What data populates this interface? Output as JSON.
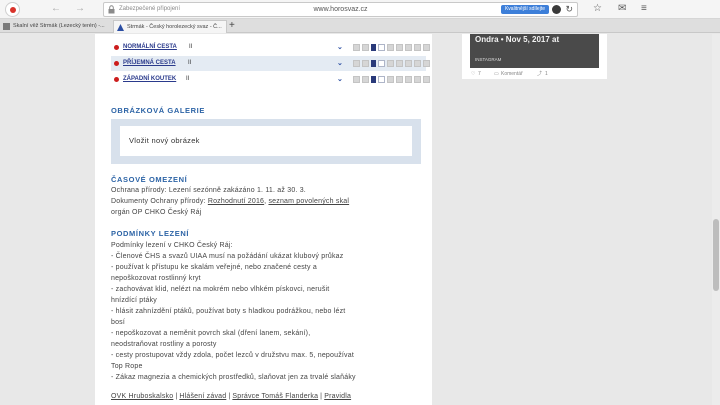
{
  "browser": {
    "secure_label": "Zabezpečené připojení",
    "url": "www.horosvaz.cz",
    "ad_button": "Kvalitnější sdílejte",
    "back_icon": "back-arrow-icon",
    "forward_icon": "forward-arrow-icon",
    "reload_icon": "reload-icon",
    "icons": {
      "star": "☆",
      "mail": "✉",
      "menu": "≡"
    },
    "tabs": [
      {
        "label": "Skalní věž Strmák (Lezecký terén) -..."
      },
      {
        "label": "Strmák - Český horolezecký svaz - Č..."
      }
    ],
    "new_tab": "+"
  },
  "routes": [
    {
      "name": "NORMÁLNÍ CESTA",
      "grade": "II"
    },
    {
      "name": "PŘÍJEMNÁ CESTA",
      "grade": "II"
    },
    {
      "name": "ZÁPADNÍ KOUTEK",
      "grade": "II"
    }
  ],
  "gallery": {
    "heading": "OBRÁZKOVÁ GALERIE",
    "add_label": "Vložit nový obrázek"
  },
  "seasonal": {
    "heading": "ČASOVÉ OMEZENÍ",
    "line1": "Ochrana přírody: Lezení sezónně zakázáno 1. 11. až 30. 3.",
    "line2_prefix": "Dokumenty Ochrany přírody: ",
    "link1": "Rozhodnutí 2016",
    "line2_mid": ", ",
    "link2": "seznam povolených skal",
    "line3": "orgán OP CHKO Český Ráj"
  },
  "conditions": {
    "heading": "PODMÍNKY LEZENÍ",
    "lines": [
      "Podmínky lezení v CHKO Český Ráj:",
      "- Členové ČHS a svazů UIAA musí na požádání ukázat klubový průkaz",
      "- používat k přístupu ke skalám veřejné, nebo značené cesty a",
      "nepoškozovat rostlinný kryt",
      "- zachovávat klid, nelézt na mokrém nebo vlhkém pískovci, nerušit",
      "hnízdící ptáky",
      "- hlásit zahnízdění ptáků, používat boty s hladkou podrážkou, nebo lézt",
      "bosí",
      "- nepoškozovat a neměnit povrch skal (dření lanem, sekání),",
      "neodstraňovat rostliny a porosty",
      "- cesty prostupovat vždy zdola, počet lezců v družstvu max. 5, nepoužívat",
      "Top Rope",
      "- Zákaz magnezia a chemických prostředků, slaňovat jen za trvalé slaňáky"
    ]
  },
  "footer_links": [
    "OVK Hruboskalsko",
    "Hlášení závad",
    "Správce Tomáš Flanderka",
    "Pravidla"
  ],
  "instagram": {
    "caption": "Ondra • Nov 5, 2017 at",
    "source": "INSTAGRAM",
    "likes": "7",
    "comment_label": "Komentář",
    "count": "1"
  }
}
